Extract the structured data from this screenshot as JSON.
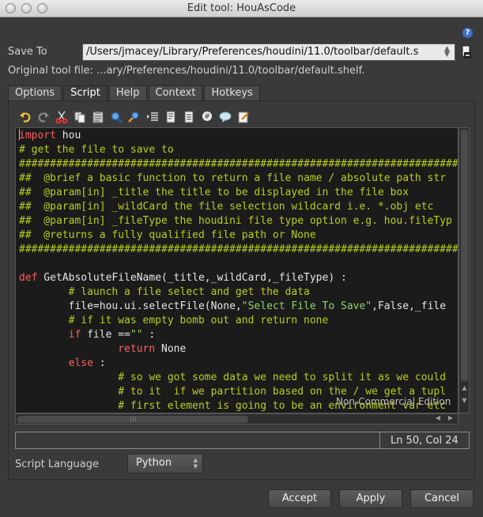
{
  "window": {
    "title": "Edit tool: HouAsCode"
  },
  "help_icon": {
    "glyph": "?"
  },
  "save_to": {
    "label": "Save To",
    "path": "/Users/jmacey/Library/Preferences/houdini/11.0/toolbar/default.s"
  },
  "original_tool_file": "Original tool file: ...ary/Preferences/houdini/11.0/toolbar/default.shelf.",
  "tabs": [
    {
      "label": "Options"
    },
    {
      "label": "Script"
    },
    {
      "label": "Help"
    },
    {
      "label": "Context"
    },
    {
      "label": "Hotkeys"
    }
  ],
  "toolbar_icons": [
    "undo-icon",
    "redo-icon",
    "cut-icon",
    "copy-icon",
    "paste-icon",
    "find-icon",
    "find-replace-icon",
    "indent-icon",
    "unindent-icon",
    "dedent-icon",
    "comment-icon",
    "uncomment-icon",
    "edit-icon"
  ],
  "code": {
    "lines": [
      [
        {
          "t": "import",
          "c": "kw"
        },
        {
          "t": " hou",
          "c": "tx"
        }
      ],
      [
        {
          "t": "# get the file to save to",
          "c": "cm"
        }
      ],
      [
        {
          "t": "##########################################################################################",
          "c": "cm"
        }
      ],
      [
        {
          "t": "##  @brief a basic function to return a file name / absolute path str",
          "c": "cm"
        }
      ],
      [
        {
          "t": "##  @param[in] _title the title to be displayed in the file box",
          "c": "cm"
        }
      ],
      [
        {
          "t": "##  @param[in] _wildCard the file selection wildcard i.e. *.obj etc",
          "c": "cm"
        }
      ],
      [
        {
          "t": "##  @param[in] _fileType the houdini file type option e.g. hou.fileTyp",
          "c": "cm"
        }
      ],
      [
        {
          "t": "##  @returns a fully qualified file path or None",
          "c": "cm"
        }
      ],
      [
        {
          "t": "##########################################################################################",
          "c": "cm"
        }
      ],
      [
        {
          "t": "",
          "c": "tx"
        }
      ],
      [
        {
          "t": "def",
          "c": "kw"
        },
        {
          "t": " GetAbsoluteFileName(_title,_wildCard,_fileType) :",
          "c": "tx"
        }
      ],
      [
        {
          "t": "        # launch a file select and get the data",
          "c": "cm"
        }
      ],
      [
        {
          "t": "        file=hou.ui.selectFile(None,",
          "c": "tx"
        },
        {
          "t": "\"Select File To Save\"",
          "c": "st"
        },
        {
          "t": ",False,_file",
          "c": "tx"
        }
      ],
      [
        {
          "t": "        # if it was empty bomb out and return none",
          "c": "cm"
        }
      ],
      [
        {
          "t": "        ",
          "c": "tx"
        },
        {
          "t": "if",
          "c": "kw"
        },
        {
          "t": " file ==",
          "c": "tx"
        },
        {
          "t": "\"\"",
          "c": "st"
        },
        {
          "t": " :",
          "c": "tx"
        }
      ],
      [
        {
          "t": "                ",
          "c": "tx"
        },
        {
          "t": "return",
          "c": "kw"
        },
        {
          "t": " None",
          "c": "tx"
        }
      ],
      [
        {
          "t": "        ",
          "c": "tx"
        },
        {
          "t": "else",
          "c": "kw"
        },
        {
          "t": " :",
          "c": "tx"
        }
      ],
      [
        {
          "t": "                # so we got some data we need to split it as we could",
          "c": "cm"
        }
      ],
      [
        {
          "t": "                # to it  if we partition based on the / we get a tupl",
          "c": "cm"
        }
      ],
      [
        {
          "t": "                # first element is going to be an environment var etc",
          "c": "cm"
        }
      ]
    ]
  },
  "watermark": "Non-Commercial Edition",
  "status": {
    "position": "Ln 50, Col 24"
  },
  "script_language": {
    "label": "Script Language",
    "value": "Python"
  },
  "buttons": {
    "accept": "Accept",
    "apply": "Apply",
    "cancel": "Cancel"
  }
}
